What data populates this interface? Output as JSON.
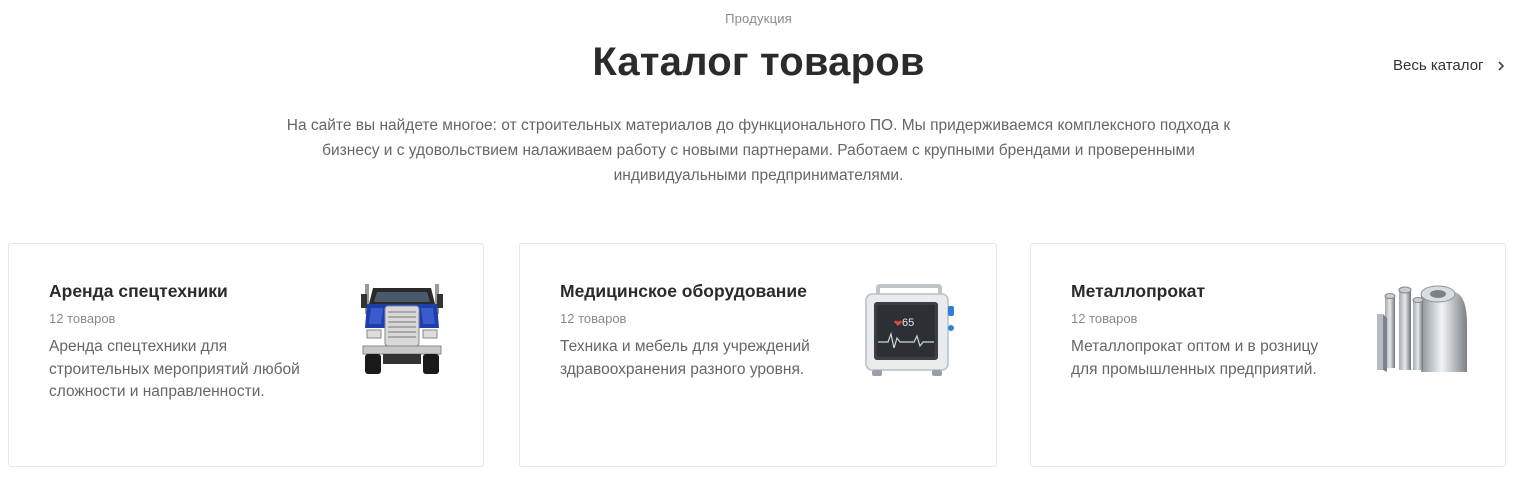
{
  "header": {
    "eyebrow": "Продукция",
    "title": "Каталог товаров",
    "all_link": "Весь каталог",
    "intro": "На сайте вы найдете многое: от строительных материалов до функционального ПО. Мы придерживаемся комплексного подхода к бизнесу и с удовольствием налаживаем работу с новыми партнерами. Работаем с крупными брендами и проверенными индивидуальными предпринимателями."
  },
  "cards": [
    {
      "title": "Аренда спецтехники",
      "count": "12 товаров",
      "description": "Аренда спецтехники для строительных мероприятий любой сложности и направленности.",
      "icon": "truck-icon"
    },
    {
      "title": "Медицинское оборудование",
      "count": "12 товаров",
      "description": "Техника и мебель для учреждений здравоохранения разного уровня.",
      "icon": "medical-monitor-icon",
      "monitor_value": "65"
    },
    {
      "title": "Металлопрокат",
      "count": "12 товаров",
      "description": "Металлопрокат оптом и в розницу для промышленных предприятий.",
      "icon": "metal-rolls-icon"
    }
  ],
  "colors": {
    "text_dark": "#2b2b2b",
    "text_muted": "#666666",
    "text_light": "#8a8a8a",
    "border": "#e6e6e6"
  }
}
